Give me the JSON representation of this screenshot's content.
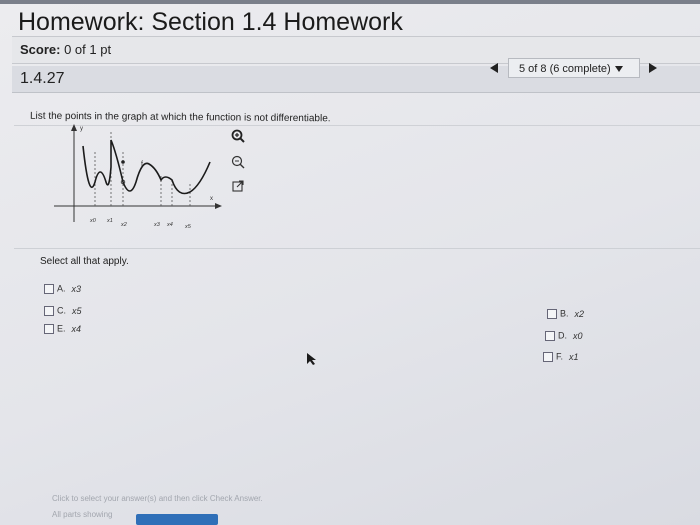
{
  "header": {
    "title": "Homework: Section 1.4 Homework"
  },
  "score": {
    "label": "Score:",
    "value": "0 of 1 pt"
  },
  "question": {
    "number": "1.4.27",
    "prompt": "List the points in the graph at which the function is not differentiable."
  },
  "navigation": {
    "progress": "5 of 8 (6 complete)"
  },
  "graph": {
    "function_label": "f",
    "x_axis_label": "x",
    "y_axis_label": "y",
    "points": [
      "x0",
      "x1",
      "x2",
      "x3",
      "x4",
      "x5"
    ]
  },
  "tools": [
    "zoom-in-icon",
    "zoom-out-icon",
    "popout-icon"
  ],
  "answer": {
    "instruction": "Select all that apply.",
    "options": [
      {
        "letter": "A.",
        "value": "x3"
      },
      {
        "letter": "B.",
        "value": "x2"
      },
      {
        "letter": "C.",
        "value": "x5"
      },
      {
        "letter": "D.",
        "value": "x0"
      },
      {
        "letter": "E.",
        "value": "x4"
      },
      {
        "letter": "F.",
        "value": "x1"
      }
    ]
  },
  "footer": {
    "help_text": "Click to select your answer(s) and then click Check Answer.",
    "parts_text": "All parts showing"
  }
}
